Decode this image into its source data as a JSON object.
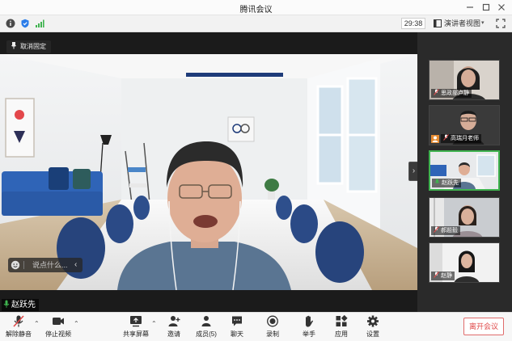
{
  "window": {
    "title": "腾讯会议"
  },
  "infobar": {
    "timer": "29:38",
    "view_label": "演讲者视图",
    "view_caret": "▾"
  },
  "stage": {
    "pin_label": "取消固定",
    "chat_placeholder": "说点什么...",
    "chat_chevron": "‹",
    "speaker_name": "赵跃先",
    "collapse_chevron": "›"
  },
  "gallery": {
    "participants": [
      {
        "name": "思政部卢静",
        "active": false
      },
      {
        "name": "高瑞月老师",
        "active": false
      },
      {
        "name": "赵跃先",
        "active": true
      },
      {
        "name": "郝题毅",
        "active": false
      },
      {
        "name": "赵静",
        "active": false
      }
    ]
  },
  "toolbar": {
    "unmute": "解除静音",
    "stop_video": "停止视频",
    "share_screen": "共享屏幕",
    "invite": "邀请",
    "members": "成员(5)",
    "chat": "聊天",
    "record": "录制",
    "raise_hand": "举手",
    "apps": "应用",
    "settings": "设置",
    "leave": "离开会议",
    "chevron": "⌃"
  },
  "colors": {
    "accent_green": "#3fb34f",
    "leave_red": "#e04a4a",
    "room_wall": "#eceef0",
    "sofa_blue": "#2f64b7"
  },
  "icons": [
    "info-icon",
    "shield-icon",
    "signal-icon",
    "speaker-view-icon",
    "fullscreen-icon",
    "pin-icon",
    "emoji-icon",
    "mic-icon",
    "camera-icon",
    "share-screen-icon",
    "invite-icon",
    "members-icon",
    "chat-icon",
    "record-icon",
    "hand-icon",
    "apps-icon",
    "gear-icon"
  ]
}
